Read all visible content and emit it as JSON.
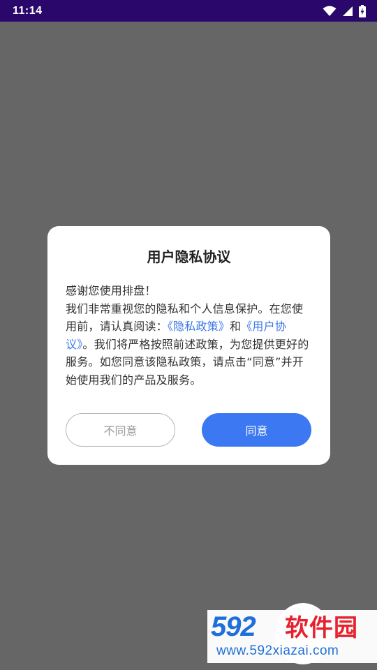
{
  "status_bar": {
    "time": "11:14",
    "icons": [
      "wifi-icon",
      "signal-icon",
      "battery-charging-icon"
    ]
  },
  "dialog": {
    "title": "用户隐私协议",
    "greeting": "感谢您使用排盘！",
    "body_part1": "我们非常重视您的隐私和个人信息保护。在您使用前，请认真阅读：",
    "link_privacy": "《隐私政策》",
    "body_and": "和",
    "link_terms": "《用户协议》",
    "body_part2": "。我们将严格按照前述政策，为您提供更好的服务。如您同意该隐私政策，请点击“同意”并开始使用我们的产品及服务。",
    "disagree_label": "不同意",
    "agree_label": "同意"
  },
  "watermark": {
    "logo_num": "592",
    "logo_text": "软件园",
    "url": "www.592xiazai.com"
  },
  "colors": {
    "status_bar": "#2a086b",
    "backdrop": "#666666",
    "accent": "#3b78f2",
    "link": "#3b78e7"
  }
}
